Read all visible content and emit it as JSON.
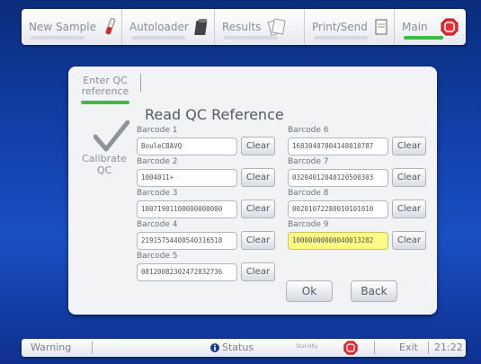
{
  "topbar": {
    "tabs": [
      {
        "label": "New Sample",
        "icon": "test-tube-icon",
        "active": false
      },
      {
        "label": "Autoloader",
        "icon": "rack-icon",
        "active": false
      },
      {
        "label": "Results",
        "icon": "result-sheets-icon",
        "active": false
      },
      {
        "label": "Print/Send",
        "icon": "printer-icon",
        "active": false
      },
      {
        "label": "Main",
        "icon": "stop-octagon-icon",
        "active": true
      }
    ]
  },
  "panel": {
    "subtab_label": "Enter QC reference",
    "side_label": "Calibrate QC",
    "title": "Read QC Reference",
    "clear_label": "Clear",
    "barcodes": [
      {
        "label": "Barcode 1",
        "value": "BouleCBAVQ"
      },
      {
        "label": "Barcode 2",
        "value": "1004011+"
      },
      {
        "label": "Barcode 3",
        "value": "10071901100000000000"
      },
      {
        "label": "Barcode 4",
        "value": "21915754400540316518"
      },
      {
        "label": "Barcode 5",
        "value": "08120082302472832736"
      },
      {
        "label": "Barcode 6",
        "value": "16830407804148010787"
      },
      {
        "label": "Barcode 7",
        "value": "03204012040120500303"
      },
      {
        "label": "Barcode 8",
        "value": "00201072280010101010"
      },
      {
        "label": "Barcode 9",
        "value": "10000000000040013282"
      }
    ],
    "ok_label": "Ok",
    "back_label": "Back"
  },
  "statusbar": {
    "warning": "Warning",
    "status": "Status",
    "standby": "Standby",
    "exit": "Exit",
    "time": "21:22"
  },
  "colors": {
    "accent_green": "#3fb84a",
    "highlight_field": "#fcfb86",
    "stop_red": "#e8303a",
    "background_blue": "#123fa8"
  }
}
